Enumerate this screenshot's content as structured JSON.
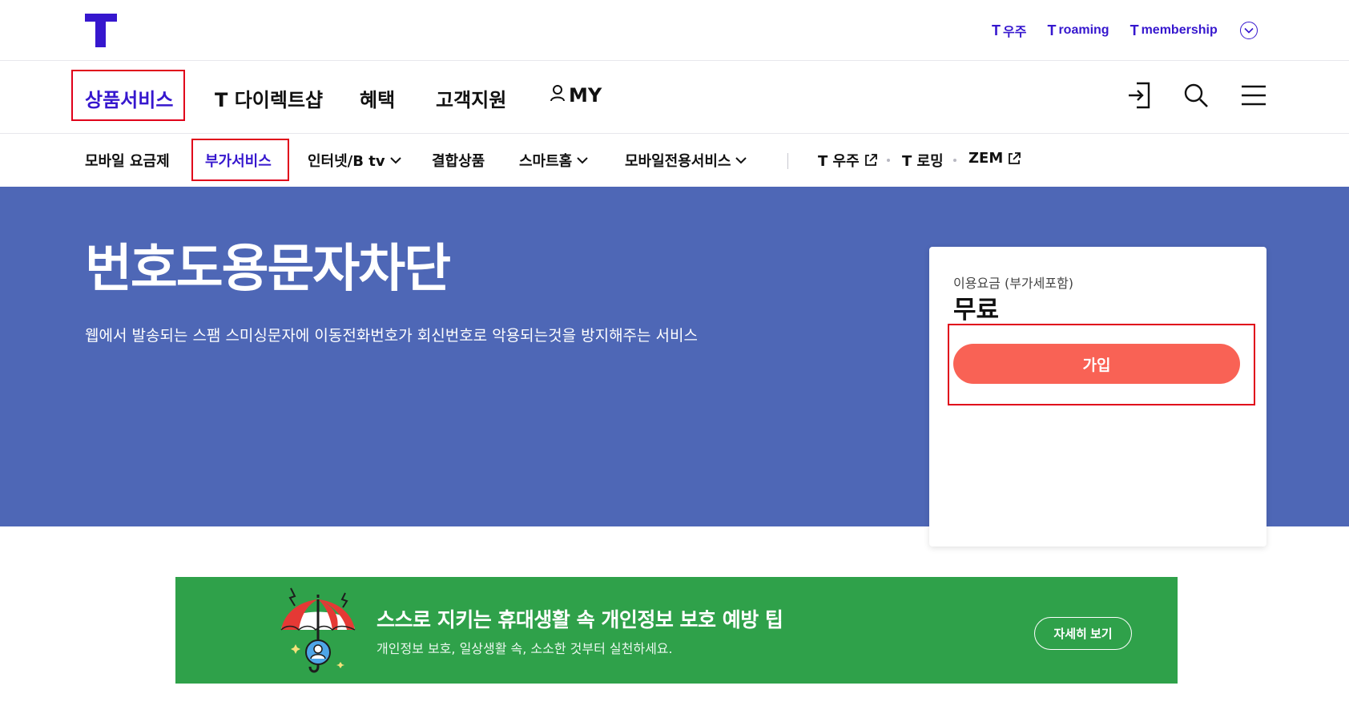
{
  "colors": {
    "brand": "#3617ce",
    "hero_bg": "#4e67b6",
    "join_button": "#f96255",
    "banner_bg": "#2fa14a",
    "highlight_box": "#e0001a"
  },
  "header": {
    "util_links": [
      {
        "prefix": "T",
        "label": "우주"
      },
      {
        "prefix": "T",
        "label": "roaming"
      },
      {
        "prefix": "T",
        "label": "membership"
      }
    ],
    "util_toggle_icon": "chevron-down-circle-icon"
  },
  "gnb": {
    "items": [
      "상품서비스",
      "T 다이렉트샵",
      "혜택",
      "고객지원",
      "MY"
    ],
    "active_index": 0,
    "icons": [
      "login-icon",
      "search-icon",
      "menu-icon"
    ]
  },
  "lnb": {
    "items": [
      {
        "label": "모바일 요금제",
        "dropdown": false
      },
      {
        "label": "부가서비스",
        "dropdown": false,
        "active": true
      },
      {
        "label": "인터넷/B tv",
        "dropdown": true
      },
      {
        "label": "결합상품",
        "dropdown": false
      },
      {
        "label": "스마트홈",
        "dropdown": true
      },
      {
        "label": "모바일전용서비스",
        "dropdown": true
      }
    ],
    "external": [
      {
        "label": "T 우주",
        "external": true
      },
      {
        "label": "T 로밍",
        "external": false
      },
      {
        "label": "ZEM",
        "external": true
      }
    ]
  },
  "hero": {
    "title": "번호도용문자차단",
    "description": "웹에서 발송되는 스팸 스미싱문자에 이동전화번호가 회신번호로 악용되는것을 방지해주는 서비스"
  },
  "price": {
    "label": "이용요금 (부가세포함)",
    "value": "무료",
    "join_label": "가입"
  },
  "banner": {
    "title": "스스로 지키는 휴대생활 속 개인정보 보호 예방 팁",
    "subtitle": "개인정보 보호, 일상생활 속, 소소한 것부터 실천하세요.",
    "button": "자세히 보기"
  }
}
